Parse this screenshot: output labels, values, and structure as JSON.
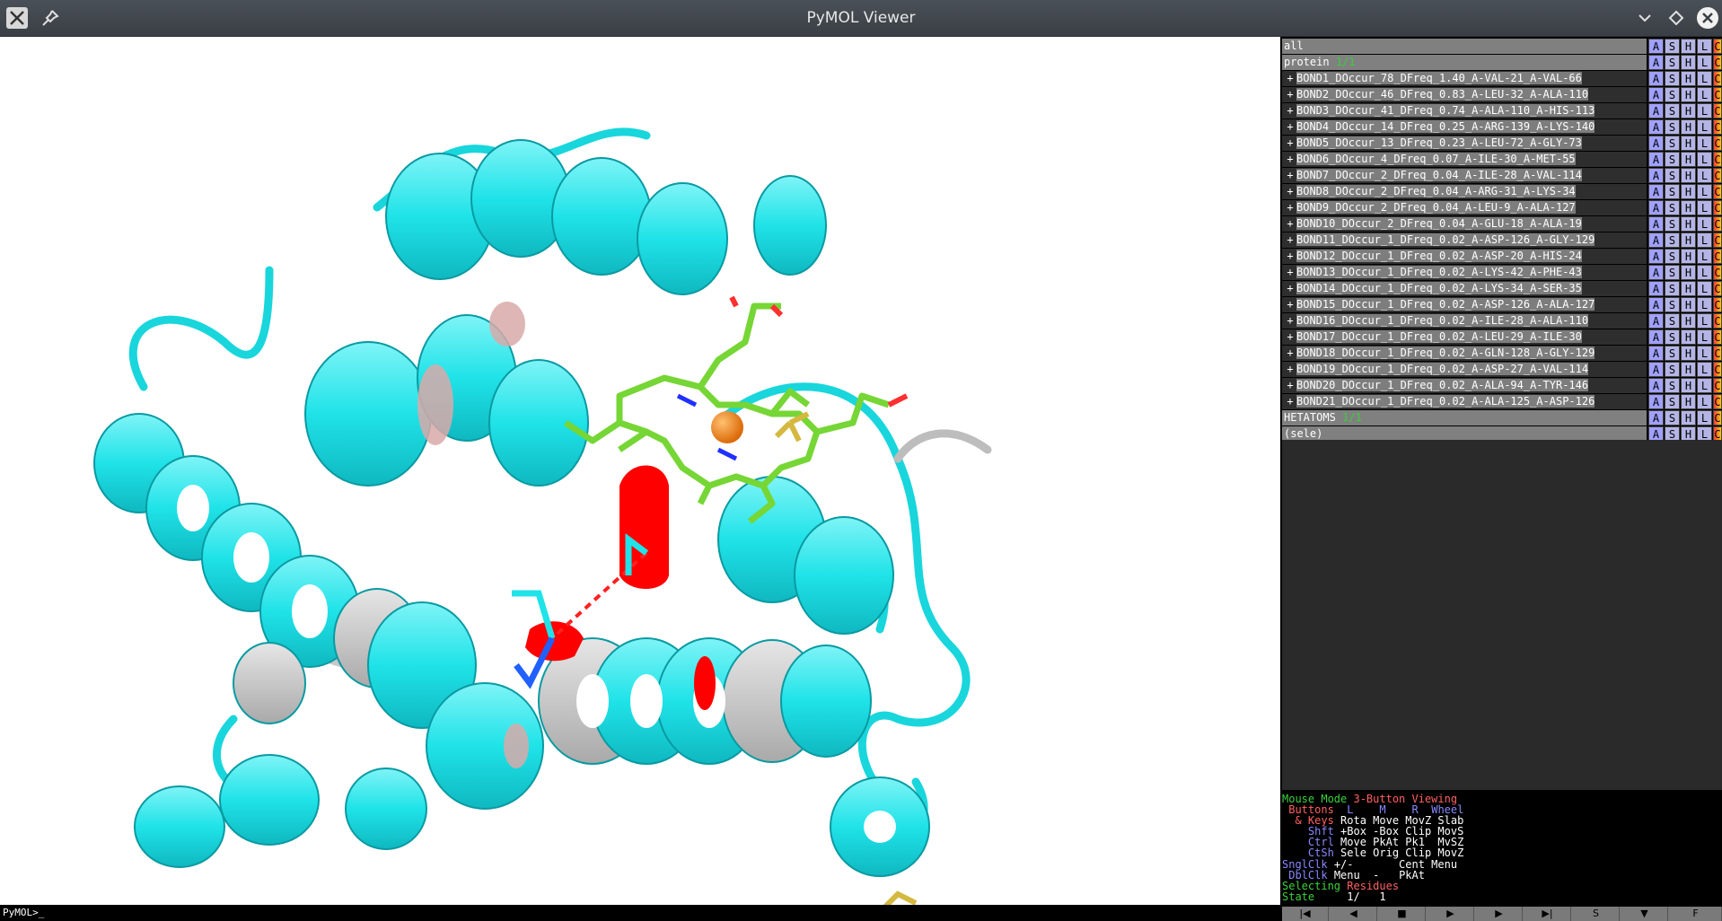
{
  "window": {
    "title": "PyMOL Viewer"
  },
  "command_line": {
    "prompt": "PyMOL>_"
  },
  "object_panel": {
    "rows": [
      {
        "name": "all",
        "count": "",
        "sub": false
      },
      {
        "name": "protein",
        "count": "1/1",
        "sub": false
      },
      {
        "name": "BOND1_DOccur_78_DFreq_1.40_A-VAL-21_A-VAL-66",
        "count": "",
        "sub": true
      },
      {
        "name": "BOND2_DOccur_46_DFreq_0.83_A-LEU-32_A-ALA-110",
        "count": "",
        "sub": true
      },
      {
        "name": "BOND3_DOccur_41_DFreq_0.74_A-ALA-110_A-HIS-113",
        "count": "",
        "sub": true
      },
      {
        "name": "BOND4_DOccur_14_DFreq_0.25_A-ARG-139_A-LYS-140",
        "count": "",
        "sub": true
      },
      {
        "name": "BOND5_DOccur_13_DFreq_0.23_A-LEU-72_A-GLY-73",
        "count": "",
        "sub": true
      },
      {
        "name": "BOND6_DOccur_4_DFreq_0.07_A-ILE-30_A-MET-55",
        "count": "",
        "sub": true
      },
      {
        "name": "BOND7_DOccur_2_DFreq_0.04_A-ILE-28_A-VAL-114",
        "count": "",
        "sub": true
      },
      {
        "name": "BOND8_DOccur_2_DFreq_0.04_A-ARG-31_A-LYS-34",
        "count": "",
        "sub": true
      },
      {
        "name": "BOND9_DOccur_2_DFreq_0.04_A-LEU-9_A-ALA-127",
        "count": "",
        "sub": true
      },
      {
        "name": "BOND10_DOccur_2_DFreq_0.04_A-GLU-18_A-ALA-19",
        "count": "",
        "sub": true
      },
      {
        "name": "BOND11_DOccur_1_DFreq_0.02_A-ASP-126_A-GLY-129",
        "count": "",
        "sub": true
      },
      {
        "name": "BOND12_DOccur_1_DFreq_0.02_A-ASP-20_A-HIS-24",
        "count": "",
        "sub": true
      },
      {
        "name": "BOND13_DOccur_1_DFreq_0.02_A-LYS-42_A-PHE-43",
        "count": "",
        "sub": true
      },
      {
        "name": "BOND14_DOccur_1_DFreq_0.02_A-LYS-34_A-SER-35",
        "count": "",
        "sub": true
      },
      {
        "name": "BOND15_DOccur_1_DFreq_0.02_A-ASP-126_A-ALA-127",
        "count": "",
        "sub": true
      },
      {
        "name": "BOND16_DOccur_1_DFreq_0.02_A-ILE-28_A-ALA-110",
        "count": "",
        "sub": true
      },
      {
        "name": "BOND17_DOccur_1_DFreq_0.02_A-LEU-29_A-ILE-30",
        "count": "",
        "sub": true
      },
      {
        "name": "BOND18_DOccur_1_DFreq_0.02_A-GLN-128_A-GLY-129",
        "count": "",
        "sub": true
      },
      {
        "name": "BOND19_DOccur_1_DFreq_0.02_A-ASP-27_A-VAL-114",
        "count": "",
        "sub": true
      },
      {
        "name": "BOND20_DOccur_1_DFreq_0.02_A-ALA-94_A-TYR-146",
        "count": "",
        "sub": true
      },
      {
        "name": "BOND21_DOccur_1_DFreq_0.02_A-ALA-125_A-ASP-126",
        "count": "",
        "sub": true
      },
      {
        "name": "HETATOMS",
        "count": "1/1",
        "sub": false
      },
      {
        "name": "(sele)",
        "count": "",
        "sub": false
      }
    ],
    "buttons": {
      "a": "A",
      "s": "S",
      "h": "H",
      "l": "L",
      "c": "C"
    }
  },
  "mouse_help": {
    "mode_label": "Mouse Mode",
    "mode_value": "3-Button Viewing",
    "buttons_label": "Buttons",
    "col_l": "L",
    "col_m": "M",
    "col_r": "R",
    "col_wheel": "Wheel",
    "keys_label": "& Keys",
    "row_none": "Rota Move MovZ Slab",
    "shft_label": "Shft",
    "row_shft": "+Box -Box Clip MovS",
    "ctrl_label": "Ctrl",
    "row_ctrl": "Move PkAt Pk1  MvSZ",
    "ctsh_label": "CtSh",
    "row_ctsh": "Sele Orig Clip MovZ",
    "sngl_label": "SnglClk",
    "row_sngl": "+/-       Cent Menu",
    "dbl_label": "DblClk",
    "row_dbl": "Menu  -   PkAt",
    "selecting_label": "Selecting",
    "selecting_value": "Residues",
    "state_label": "State",
    "state_value": "1/   1"
  },
  "transport": {
    "s": "S",
    "f": "F"
  },
  "colors": {
    "cartoon": "#1fe3e8",
    "bond_red": "#ff0000",
    "ligand": "#76d635",
    "iron": "#f07c10"
  }
}
